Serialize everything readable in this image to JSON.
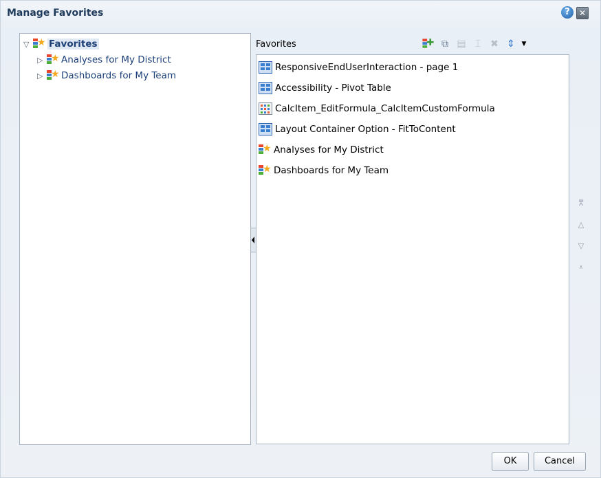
{
  "dialog": {
    "title": "Manage Favorites",
    "help_label": "?",
    "close_label": "✕"
  },
  "tree": {
    "root": {
      "label": "Favorites",
      "toggle": "▽"
    },
    "children": [
      {
        "label": "Analyses for My District",
        "toggle": "▷"
      },
      {
        "label": "Dashboards for My Team",
        "toggle": "▷"
      }
    ]
  },
  "right": {
    "header": "Favorites",
    "toolbar": {
      "new_category_icon": "new-category-icon",
      "copy_icon": "copy-icon",
      "paste_icon": "paste-icon",
      "rename_icon": "rename-icon",
      "delete_icon": "delete-icon",
      "sort_icon": "sort-icon",
      "dropdown_icon": "chevron-down-icon"
    },
    "items": [
      {
        "label": "ResponsiveEndUserInteraction - page 1",
        "icon": "dashboard-page-icon"
      },
      {
        "label": "Accessibility - Pivot Table",
        "icon": "dashboard-page-icon"
      },
      {
        "label": "CalcItem_EditFormula_CalcItemCustomFormula",
        "icon": "analysis-icon"
      },
      {
        "label": "Layout Container Option - FitToContent",
        "icon": "dashboard-page-icon"
      },
      {
        "label": "Analyses for My District",
        "icon": "favorites-category-icon"
      },
      {
        "label": "Dashboards for My Team",
        "icon": "favorites-category-icon"
      }
    ]
  },
  "move_buttons": {
    "top": "move-to-top-icon",
    "up": "move-up-icon",
    "down": "move-down-icon",
    "bottom": "move-to-bottom-icon"
  },
  "buttons": {
    "ok": "OK",
    "cancel": "Cancel"
  },
  "colors": {
    "accent": "#1c3f78",
    "title": "#1f3b5c",
    "border": "#a7b3c0"
  }
}
